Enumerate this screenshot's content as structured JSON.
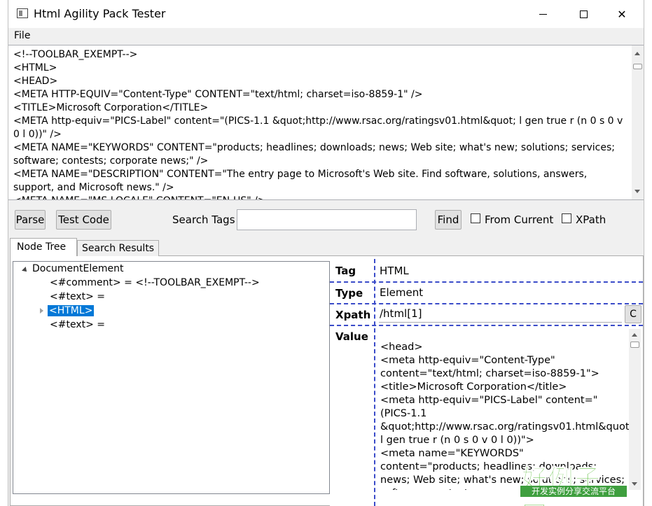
{
  "window": {
    "title": "Html Agility Pack Tester"
  },
  "menu": {
    "file": "File"
  },
  "source": {
    "lines": [
      "<!--TOOLBAR_EXEMPT-->",
      "<HTML>",
      "<HEAD>",
      "<META HTTP-EQUIV=\"Content-Type\" CONTENT=\"text/html; charset=iso-8859-1\" />",
      "<TITLE>Microsoft Corporation</TITLE>",
      "<META http-equiv=\"PICS-Label\" content=\"(PICS-1.1 &quot;http://www.rsac.org/ratingsv01.html&quot; l gen true r (n 0 s 0 v 0 l 0))\" />",
      "<META NAME=\"KEYWORDS\" CONTENT=\"products; headlines; downloads; news; Web site; what's new; solutions; services; software; contests; corporate news;\" />",
      "<META NAME=\"DESCRIPTION\" CONTENT=\"The entry page to Microsoft's Web site. Find software, solutions, answers, support, and Microsoft news.\" />",
      "<META NAME=\"MS.LOCALE\" CONTENT=\"EN-US\" />"
    ]
  },
  "toolbar": {
    "parse": "Parse",
    "test_code": "Test Code",
    "search_label": "Search Tags",
    "search_value": "",
    "find": "Find",
    "from_current": "From Current",
    "xpath": "XPath"
  },
  "tabs": {
    "node_tree": "Node Tree",
    "search_results": "Search Results"
  },
  "tree": {
    "root": "DocumentElement",
    "comment": "<#comment> = <!--TOOLBAR_EXEMPT-->",
    "text1": "<#text> =",
    "html": "<HTML>",
    "text2": "<#text> ="
  },
  "props": {
    "tag_label": "Tag",
    "tag_value": "HTML",
    "type_label": "Type",
    "type_value": "Element",
    "xpath_label": "Xpath",
    "xpath_value": "/html[1]",
    "copy": "C",
    "value_label": "Value",
    "value_text": "<head>\n<meta http-equiv=\"Content-Type\" content=\"text/html; charset=iso-8859-1\">\n<title>Microsoft Corporation</title>\n<meta http-equiv=\"PICS-Label\" content=\"(PICS-1.1 &quot;http://www.rsac.org/ratingsv01.html&quot; l gen true r (n 0 s 0 v 0 l 0))\">\n<meta name=\"KEYWORDS\" content=\"products; headlines; downloads; news; Web site; what's new; solutions; services; software; contests;"
  },
  "watermark": {
    "big": "好例子网",
    "small": "开发实例分享交流平台"
  }
}
